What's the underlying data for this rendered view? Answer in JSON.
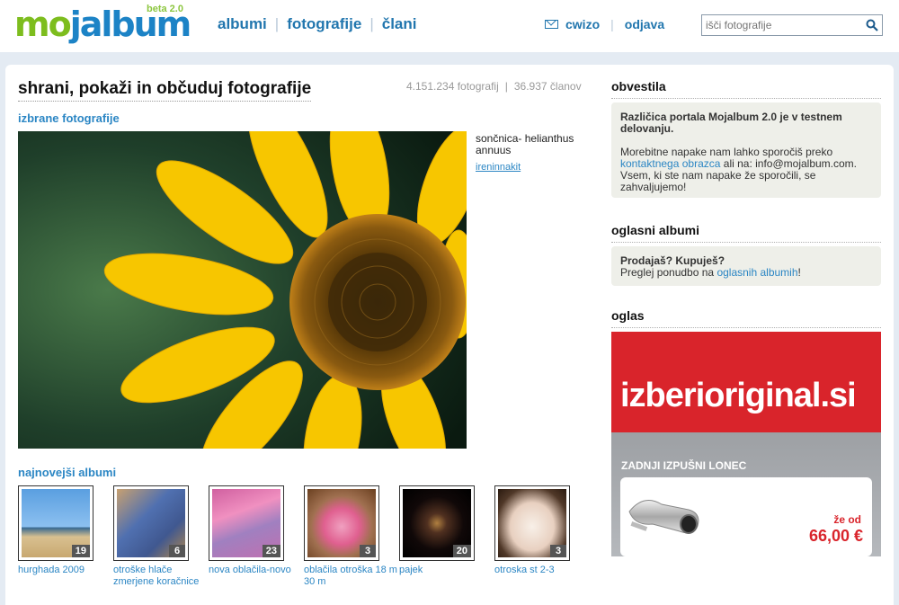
{
  "logo": {
    "text_mo": "mo",
    "text_rest": "jalbum",
    "beta": "beta 2.0"
  },
  "nav": {
    "albums": "albumi",
    "photos": "fotografije",
    "members": "člani"
  },
  "user": {
    "name": "cwizo",
    "logout": "odjava"
  },
  "search": {
    "placeholder": "išči fotografije",
    "icon": "search-icon"
  },
  "main": {
    "title": "shrani, pokaži in občuduj fotografije",
    "stats_photos": "4.151.234 fotografij",
    "stats_sep": "|",
    "stats_members": "36.937 članov",
    "featured_label": "izbrane fotografije",
    "featured_title": "sončnica- helianthus annuus",
    "featured_user": "ireninnakit",
    "albums_label": "najnovejši albumi"
  },
  "albums": [
    {
      "label": "hurghada 2009",
      "count": "19"
    },
    {
      "label": "otroške hlače zmerjene koračnice",
      "count": "6"
    },
    {
      "label": "nova oblačila-novo",
      "count": "23"
    },
    {
      "label": "oblačila otroška 18 m 30 m",
      "count": "3"
    },
    {
      "label": "pajek",
      "count": "20"
    },
    {
      "label": "otroska st 2-3",
      "count": "3"
    }
  ],
  "sidebar": {
    "notices_heading": "obvestila",
    "notice_bold": "Različica portala Mojalbum 2.0 je v testnem delovanju.",
    "notice_text1": "Morebitne napake nam lahko sporočiš preko",
    "notice_link": "kontaktnega obrazca",
    "notice_text2": "ali na: info@mojalbum.com. Vsem, ki ste nam napake že sporočili, se zahvaljujemo!",
    "ads_heading": "oglasni albumi",
    "ads_bold": "Prodajaš? Kupuješ?",
    "ads_text1": "Preglej ponudbo na",
    "ads_link": "oglasnih albumih",
    "ads_text2": "!",
    "ad_heading": "oglas"
  },
  "ad": {
    "brand": "izberioriginal.si",
    "subtitle": "ZADNJI IZPUŠNI LONEC",
    "from": "že od",
    "price": "66,00 €"
  },
  "colors": {
    "accent": "#2b86c4",
    "brand_green": "#7dbd1e",
    "ad_red": "#d9242b"
  }
}
